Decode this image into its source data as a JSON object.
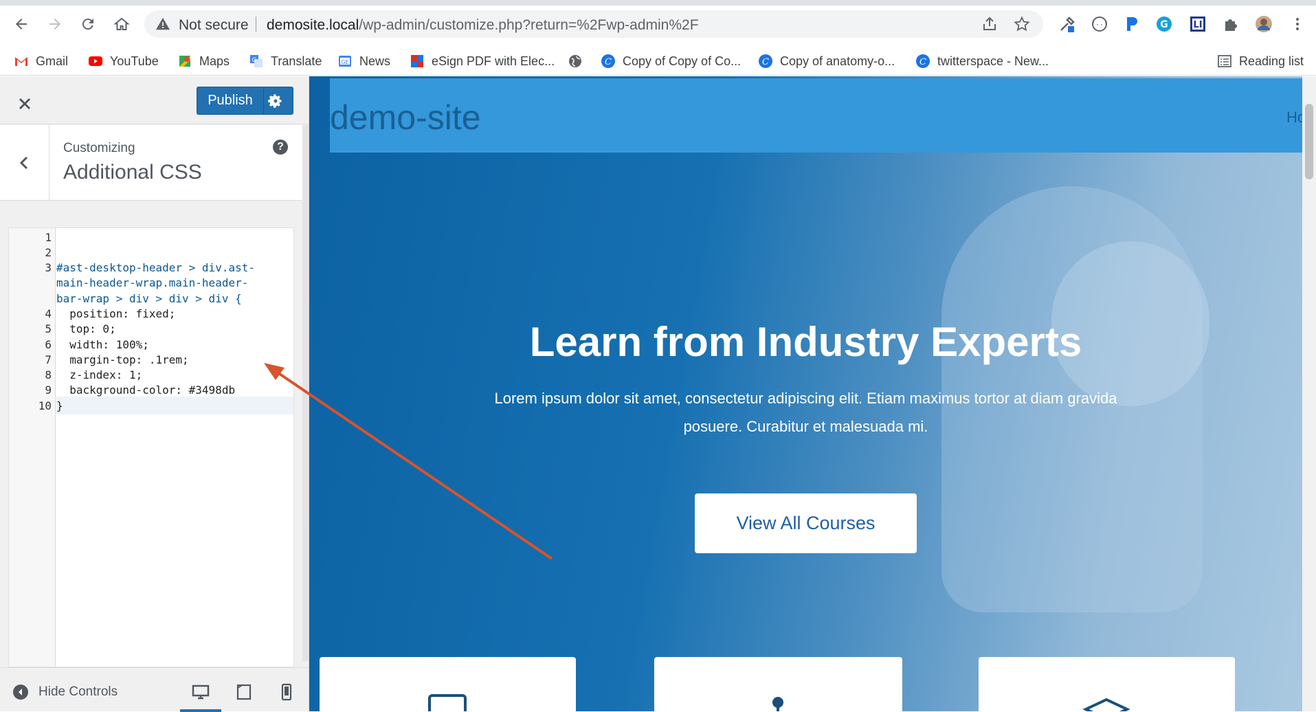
{
  "browser": {
    "address_security": "Not secure",
    "url_host": "demosite.local",
    "url_path": "/wp-admin/customize.php?return=%2Fwp-admin%2F",
    "bookmarks": [
      {
        "label": "Gmail",
        "icon": "gmail-icon"
      },
      {
        "label": "YouTube",
        "icon": "youtube-icon"
      },
      {
        "label": "Maps",
        "icon": "maps-icon"
      },
      {
        "label": "Translate",
        "icon": "translate-icon"
      },
      {
        "label": "News",
        "icon": "news-icon"
      },
      {
        "label": "eSign PDF with Elec...",
        "icon": "esign-icon"
      },
      {
        "label": "",
        "icon": "globe-icon"
      },
      {
        "label": "Copy of Copy of Co...",
        "icon": "c-icon"
      },
      {
        "label": "Copy of anatomy-o...",
        "icon": "c-icon"
      },
      {
        "label": "twitterspace - New...",
        "icon": "c-icon"
      }
    ],
    "reading_list": "Reading list"
  },
  "customizer": {
    "publish_label": "Publish",
    "customizing_label": "Customizing",
    "section_title": "Additional CSS",
    "help_glyph": "?",
    "hide_controls": "Hide Controls",
    "accent": "#2271b1"
  },
  "editor": {
    "line_numbers": [
      "1",
      "2",
      "3",
      "4",
      "5",
      "6",
      "7",
      "8",
      "9",
      "10"
    ],
    "code_lines": [
      "",
      "",
      "#ast-desktop-header > div.ast-",
      "main-header-wrap.main-header-",
      "bar-wrap > div > div > div {",
      "  position: fixed;",
      "  top: 0;",
      "  width: 100%;",
      "  margin-top: .1rem;",
      "  z-index: 1;",
      "  background-color: #3498db",
      "}"
    ]
  },
  "preview": {
    "site_title": "demo-site",
    "nav_home": "Home",
    "hero_title": "Learn from Industry Experts",
    "hero_text": "Lorem ipsum dolor sit amet, consectetur adipiscing elit. Etiam maximus tortor at diam gravida posuere. Curabitur et malesuada mi.",
    "cta_label": "View All Courses",
    "header_color": "#3498db"
  },
  "annotation": {
    "arrow_color": "#d9532c"
  }
}
